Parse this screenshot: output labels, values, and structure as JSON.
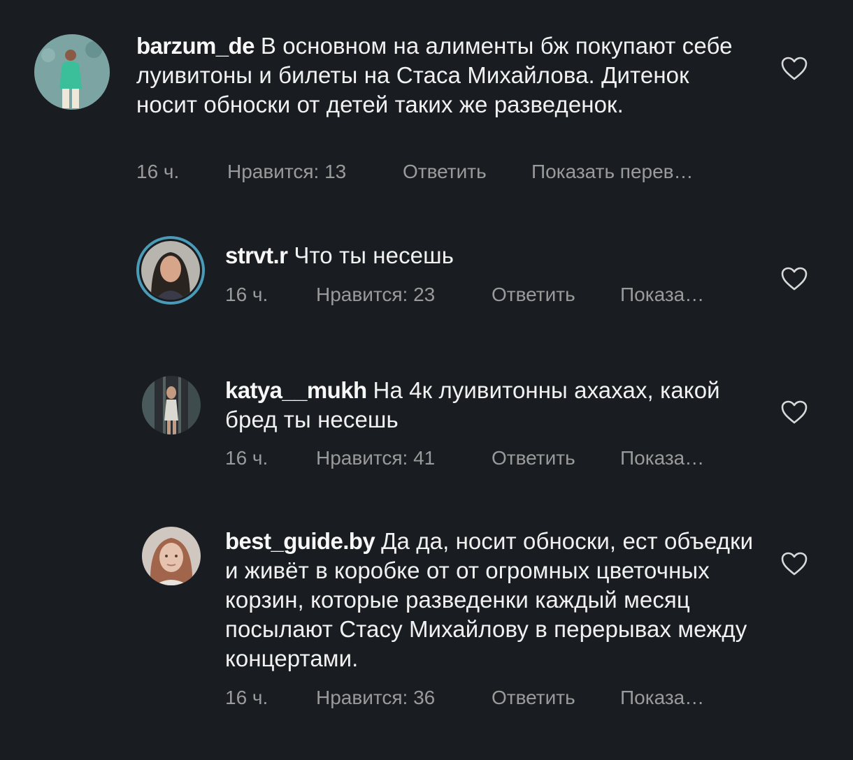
{
  "comments": [
    {
      "username": "barzum_de",
      "text": "В основном на алименты бж покупают себе луивитоны и билеты на Стаса Михайлова. Дитенок носит обноски от детей таких же разведенок.",
      "time": "16 ч.",
      "likes": "Нравится: 13",
      "reply": "Ответить",
      "translate": "Показать перев…",
      "avatar_icon": "avatar-man-green-shirt"
    },
    {
      "username": "strvt.r",
      "text": "Что ты несешь",
      "time": "16 ч.",
      "likes": "Нравится: 23",
      "reply": "Ответить",
      "translate": "Показа…",
      "avatar_icon": "avatar-woman-story-ring"
    },
    {
      "username": "katya__mukh",
      "text": "На 4к луивитонны ахахах, какой бред ты несешь",
      "time": "16 ч.",
      "likes": "Нравится: 41",
      "reply": "Ответить",
      "translate": "Показа…",
      "avatar_icon": "avatar-woman-dark-photo"
    },
    {
      "username": "best_guide.by",
      "text": "Да да, носит обноски, ест объедки и живёт в коробке от от огромных цветочных корзин, которые разведенки каждый месяц посылают Стасу Михайлову в перерывах между концертами.",
      "time": "16 ч.",
      "likes": "Нравится: 36",
      "reply": "Ответить",
      "translate": "Показа…",
      "avatar_icon": "avatar-woman-light-photo"
    }
  ],
  "icons": {
    "like": "heart-outline-icon"
  },
  "colors": {
    "background": "#191c20",
    "text": "#f1f1f1",
    "meta": "#9a9a9a",
    "story_ring": "#4a9bb8"
  }
}
